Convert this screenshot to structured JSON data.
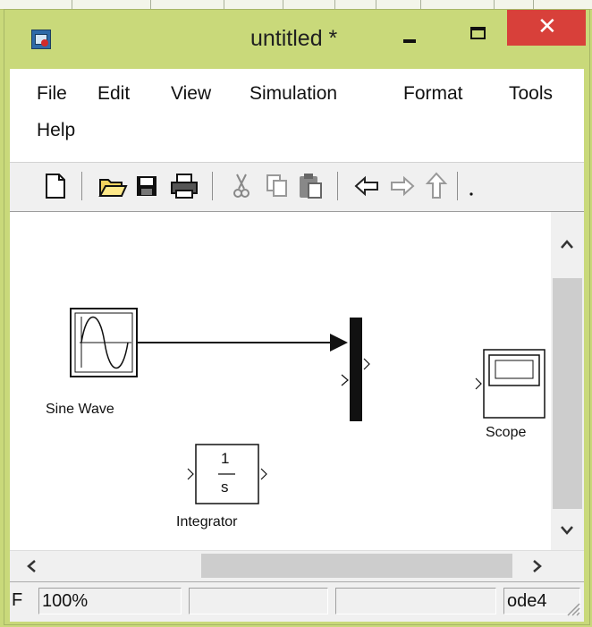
{
  "window": {
    "title": "untitled *"
  },
  "menu": {
    "items": [
      "File",
      "Edit",
      "View",
      "Simulation",
      "Format",
      "Tools",
      "Help"
    ]
  },
  "toolbar": {
    "icons": [
      "new-icon",
      "open-folder-icon",
      "save-icon",
      "print-icon",
      "cut-icon",
      "copy-icon",
      "paste-icon",
      "back-arrow-icon",
      "forward-arrow-icon",
      "up-arrow-icon"
    ]
  },
  "diagram": {
    "blocks": {
      "sine_wave": "Sine Wave",
      "integrator": "Integrator",
      "integrator_numerator": "1",
      "integrator_denominator": "s",
      "scope": "Scope"
    }
  },
  "status": {
    "left_cell": "F",
    "zoom": "100%",
    "cell_3": "",
    "cell_4": "",
    "solver": "ode4"
  },
  "colors": {
    "frame": "#c9d97a",
    "close_button": "#d8403a"
  }
}
